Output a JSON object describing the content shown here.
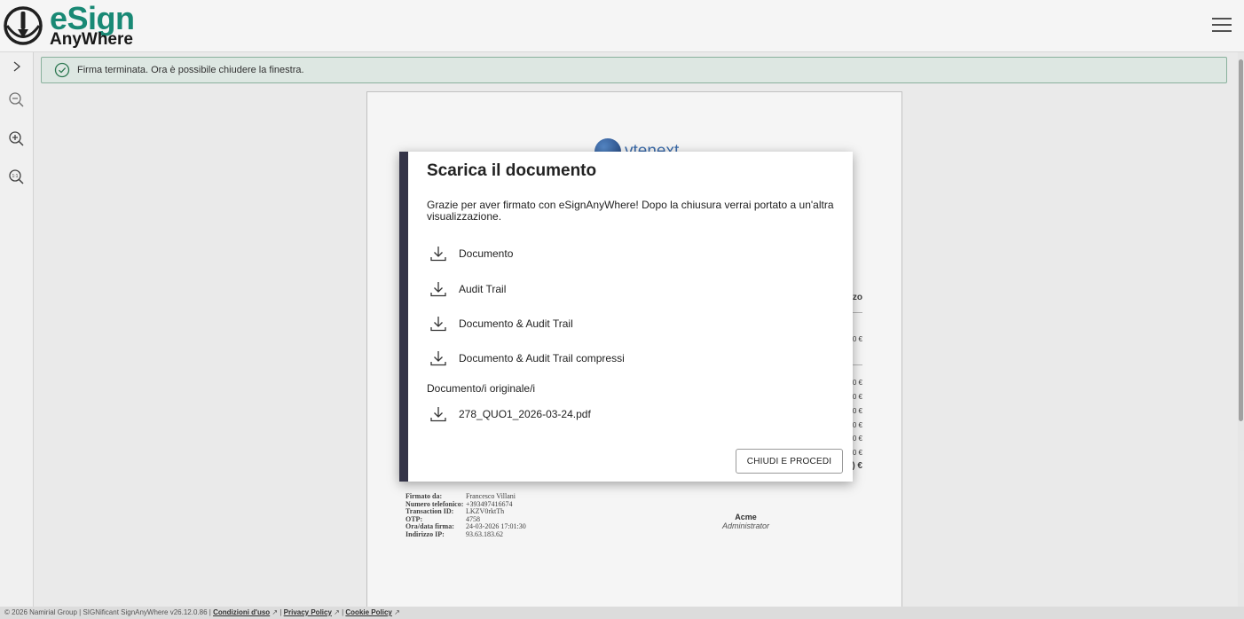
{
  "brand": {
    "name_line1": "eSign",
    "name_line2": "AnyWhere",
    "color": "#1b8f7a"
  },
  "notification": {
    "icon": "check-circle-icon",
    "text": "Firma terminata. Ora è possibile chiudere la finestra."
  },
  "left_toolbar": [
    {
      "icon": "chevron-right-icon"
    },
    {
      "icon": "zoom-out-icon"
    },
    {
      "icon": "zoom-in-icon"
    },
    {
      "icon": "zoom-reset-icon"
    }
  ],
  "document": {
    "brand_text": "vtenext",
    "fragments": [
      "zo",
      "0 €",
      "0 €",
      "0 €",
      "0 €",
      "0 €",
      "0 €",
      "0 €"
    ],
    "total_fragment": ") €",
    "signature": [
      {
        "k": "Firmato da:",
        "v": "Francesco Villani"
      },
      {
        "k": "Numero telefonico:",
        "v": "+393497416674"
      },
      {
        "k": "Transaction ID:",
        "v": "LKZV0rktTh"
      },
      {
        "k": "OTP:",
        "v": "4758"
      },
      {
        "k": "Ora/data firma:",
        "v": "24-03-2026 17:01:30"
      },
      {
        "k": "Indirizzo IP:",
        "v": "93.63.183.62"
      }
    ],
    "company": "Acme",
    "role": "Administrator"
  },
  "modal": {
    "title": "Scarica il documento",
    "description": "Grazie per aver firmato con eSignAnyWhere! Dopo la chiusura verrai portato a un'altra visualizzazione.",
    "downloads": [
      "Documento",
      "Audit Trail",
      "Documento & Audit Trail",
      "Documento & Audit Trail compressi"
    ],
    "originals_label": "Documento/i originale/i",
    "original_file": "278_QUO1_2026-03-24.pdf",
    "close_button": "CHIUDI E PROCEDI",
    "accent": "#343448"
  },
  "footer": {
    "copyright": "© 2026 Namirial Group | SIGNificant SignAnyWhere v26.12.0.86 | ",
    "terms": "Condizioni d'uso",
    "privacy": "Privacy Policy",
    "cookie": "Cookie Policy",
    "sep": " | "
  }
}
